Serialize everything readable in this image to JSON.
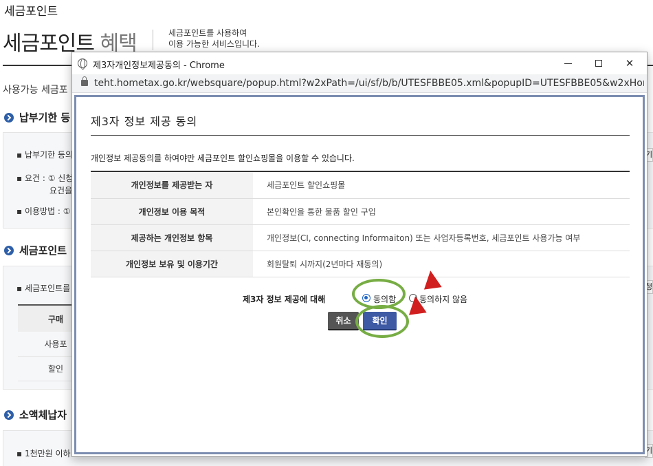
{
  "background": {
    "breadcrumb": "세금포인트",
    "title_main": "세금포인트",
    "title_light": "혜택",
    "desc_line1": "세금포인트를 사용하여",
    "desc_line2": "이용 가능한 서비스입니다.",
    "subtitle": "사용가능 세금포",
    "section1": "납부기한 등",
    "box1_lines": [
      "▪ 납부기한 등의",
      "▪ 요건 : ① 신청",
      "요건을",
      "▪ 이용방법 : ①"
    ],
    "section2": "세금포인트",
    "box2_line": "▪ 세금포인트를",
    "table_header": "구매",
    "table_rows": [
      "사용포",
      "할인"
    ],
    "section3": "소액체납자",
    "box3_line": "▪ 1천만원 이하",
    "edge_glyphs": [
      "기",
      "청",
      "기"
    ]
  },
  "window": {
    "title": "제3자개인정보제공동의 - Chrome",
    "url": "teht.hometax.go.kr/websquare/popup.html?w2xPath=/ui/sf/b/b/UTESFBBE05.xml&popupID=UTESFBBE05&w2xHome...",
    "controls": {
      "minimize": "minimize",
      "maximize": "maximize",
      "close": "✕"
    }
  },
  "dialog": {
    "title": "제3자 정보 제공 동의",
    "notice": "개인정보 제공동의를 하여야만 세금포인트 할인쇼핑몰을 이용할 수 있습니다.",
    "rows": [
      {
        "label": "개인정보를 제공받는 자",
        "value": "세금포인트 할인쇼핑몰"
      },
      {
        "label": "개인정보 이용 목적",
        "value": "본인확인을 통한 물품 할인 구입"
      },
      {
        "label": "제공하는 개인정보 항목",
        "value": "개인정보(CI, connecting Informaiton) 또는 사업자등록번호, 세금포인트 사용가능 여부"
      },
      {
        "label": "개인정보 보유 및 이용기간",
        "value": "회원탈퇴 시까지(2년마다 재동의)"
      }
    ],
    "agree_label": "제3자 정보 제공에 대해",
    "options": [
      {
        "label": "동의함",
        "selected": true
      },
      {
        "label": "동의하지 않음",
        "selected": false
      }
    ],
    "cancel_button": "취소",
    "confirm_button": "확인"
  },
  "colors": {
    "frame_border": "#7c8db0",
    "confirm_button": "#3f5aa5",
    "cancel_button": "#555555",
    "annotation_ring": "#77ad44",
    "annotation_arrow": "#d11f1f"
  }
}
